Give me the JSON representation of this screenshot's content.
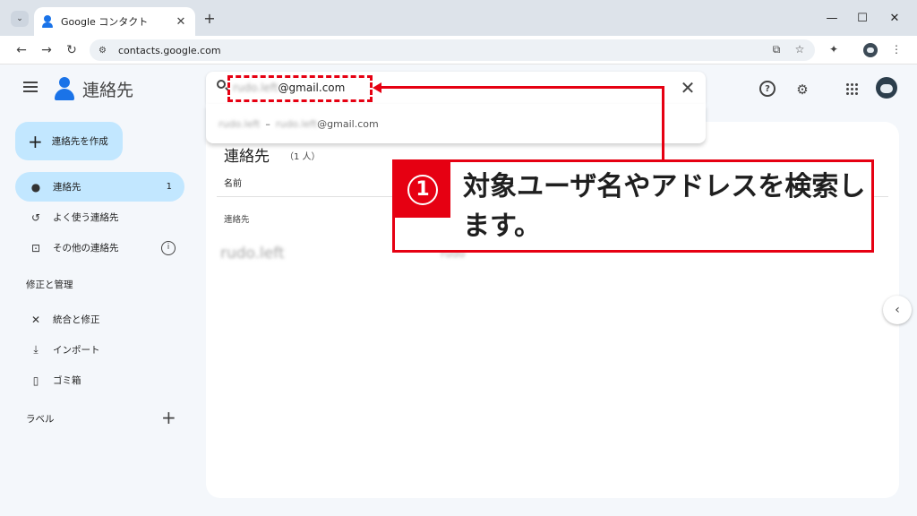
{
  "browser": {
    "tab_title": "Google コンタクト",
    "tab_close": "✕",
    "new_tab": "+",
    "url": "contacts.google.com",
    "win_minimize": "—",
    "win_maximize": "☐",
    "win_close": "✕",
    "icons": [
      "back-icon",
      "forward-icon",
      "reload-icon",
      "site-info-icon",
      "install-icon",
      "star-icon",
      "extensions-icon",
      "profile-icon",
      "menu-icon"
    ]
  },
  "app": {
    "title": "連絡先",
    "search": {
      "blurred_part": "rudo.left",
      "domain_part": "@gmail.com",
      "clear": "✕"
    },
    "suggestion": {
      "name": "rudo.left",
      "separator": "–",
      "email_local": "rudo.left",
      "email_domain": "@gmail.com"
    },
    "create_button": "連絡先を作成",
    "nav": [
      {
        "label": "連絡先",
        "count": "1",
        "icon": "person-icon",
        "active": true
      },
      {
        "label": "よく使う連絡先",
        "icon": "history-icon"
      },
      {
        "label": "その他の連絡先",
        "icon": "archive-download-icon",
        "info": "i"
      }
    ],
    "section_fix": "修正と管理",
    "fix_items": [
      {
        "label": "統合と修正",
        "icon": "tools-icon"
      },
      {
        "label": "インポート",
        "icon": "download-icon"
      },
      {
        "label": "ゴミ箱",
        "icon": "trash-icon"
      }
    ],
    "section_labels": "ラベル",
    "list": {
      "title": "連絡先",
      "count": "（1 人）",
      "column_name": "名前",
      "group": "連絡先",
      "row_name": "rudo.left",
      "row_email": "rudo"
    }
  },
  "annotation": {
    "number": "1",
    "text": "対象ユーザ名やアドレスを検索します。",
    "color": "#e60012"
  }
}
